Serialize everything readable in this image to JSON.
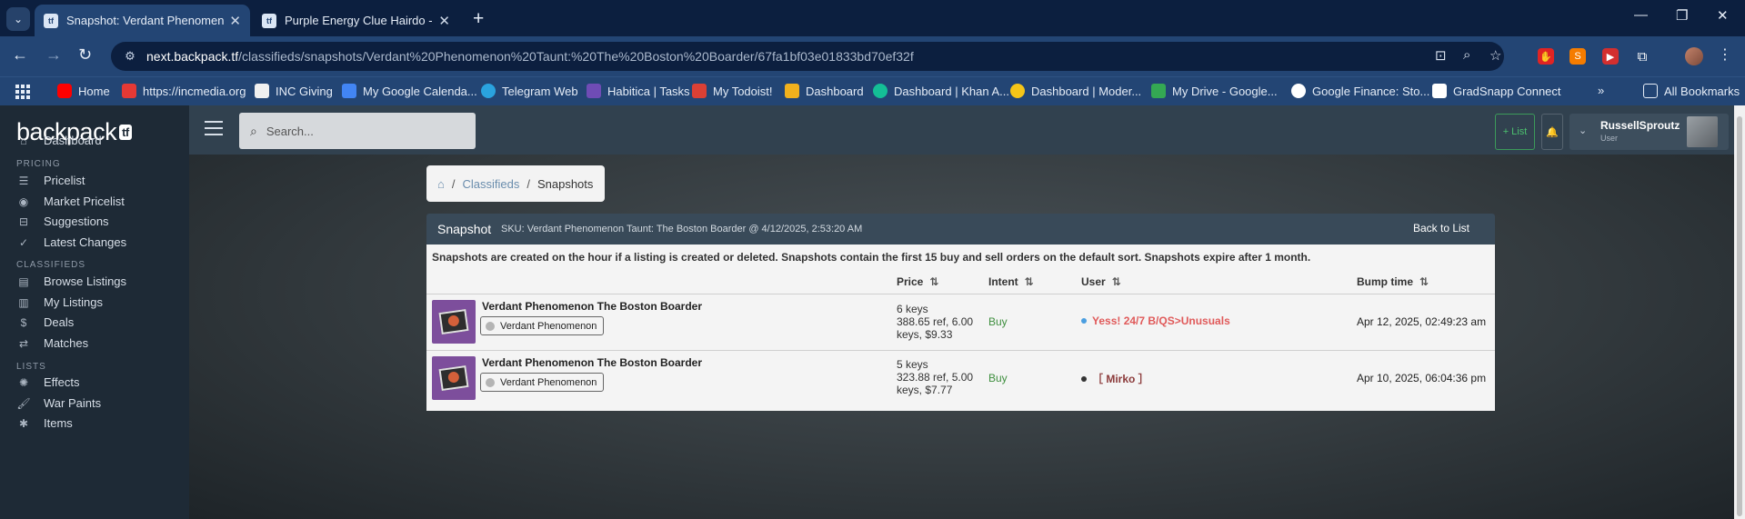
{
  "browser": {
    "tabs": [
      {
        "title": "Snapshot: Verdant Phenomenon",
        "favicon": "tf",
        "active": true
      },
      {
        "title": "Purple Energy Clue Hairdo - ba",
        "favicon": "tf",
        "active": false
      }
    ],
    "url_host": "next.backpack.tf",
    "url_path": "/classifieds/snapshots/Verdant%20Phenomenon%20Taunt:%20The%20Boston%20Boarder/67fa1bf03e01833bd70ef32f",
    "bookmarks": [
      {
        "label": "Home",
        "color": "#ff0000"
      },
      {
        "label": "https://incmedia.org",
        "color": "#e53935"
      },
      {
        "label": "INC Giving",
        "color": "#ffffff"
      },
      {
        "label": "My Google Calenda...",
        "color": "#4285f4"
      },
      {
        "label": "Telegram Web",
        "color": "#2aa3df"
      },
      {
        "label": "Habitica | Tasks",
        "color": "#6f4cb5"
      },
      {
        "label": "My Todoist!",
        "color": "#db4035"
      },
      {
        "label": "Dashboard",
        "color": "#f1b11d"
      },
      {
        "label": "Dashboard | Khan A...",
        "color": "#14bf96"
      },
      {
        "label": "Dashboard | Moder...",
        "color": "#f5c518"
      },
      {
        "label": "My Drive - Google...",
        "color": "#34a853"
      },
      {
        "label": "Google Finance: Sto...",
        "color": "#ffffff"
      },
      {
        "label": "GradSnapp Connect",
        "color": "#ffffff"
      }
    ],
    "all_bookmarks_label": "All Bookmarks"
  },
  "sidebar": {
    "logo": "backpack",
    "logo_badge": "tf",
    "dashboard": "Dashboard",
    "pricing_section": "PRICING",
    "pricing_items": [
      "Pricelist",
      "Market Pricelist",
      "Suggestions",
      "Latest Changes"
    ],
    "classifieds_section": "CLASSIFIEDS",
    "classifieds_items": [
      "Browse Listings",
      "My Listings",
      "Deals",
      "Matches"
    ],
    "lists_section": "LISTS",
    "lists_items": [
      "Effects",
      "War Paints",
      "Items"
    ]
  },
  "topbar": {
    "search_placeholder": "Search...",
    "list_button": "+ List",
    "username": "RussellSproutz",
    "user_role": "User"
  },
  "breadcrumb": {
    "classifieds": "Classifieds",
    "snapshots": "Snapshots"
  },
  "snapshot": {
    "title": "Snapshot",
    "sku_line": "SKU: Verdant Phenomenon Taunt: The Boston Boarder @ 4/12/2025, 2:53:20 AM",
    "back_label": "Back to List",
    "note": "Snapshots are created on the hour if a listing is created or deleted. Snapshots contain the first 15 buy and sell orders on the default sort. Snapshots expire after 1 month.",
    "columns": {
      "price": "Price",
      "intent": "Intent",
      "user": "User",
      "bump": "Bump time"
    },
    "rows": [
      {
        "item_name": "Verdant Phenomenon The Boston Boarder",
        "effect_badge": "Verdant Phenomenon",
        "price_keys": "6 keys",
        "price_detail": "388.65 ref, 6.00 keys, $9.33",
        "intent": "Buy",
        "user": "Yess! 24/7 B/QS>Unusuals",
        "user_color": "#e05a5a",
        "status_color": "#4a9ee0",
        "bump_time": "Apr 12, 2025, 02:49:23 am"
      },
      {
        "item_name": "Verdant Phenomenon The Boston Boarder",
        "effect_badge": "Verdant Phenomenon",
        "price_keys": "5 keys",
        "price_detail": "323.88 ref, 5.00 keys, $7.77",
        "intent": "Buy",
        "user": "［ Mirko ］",
        "user_color": "#8b3a3a",
        "status_color": "#333333",
        "bump_time": "Apr 10, 2025, 06:04:36 pm"
      }
    ]
  }
}
